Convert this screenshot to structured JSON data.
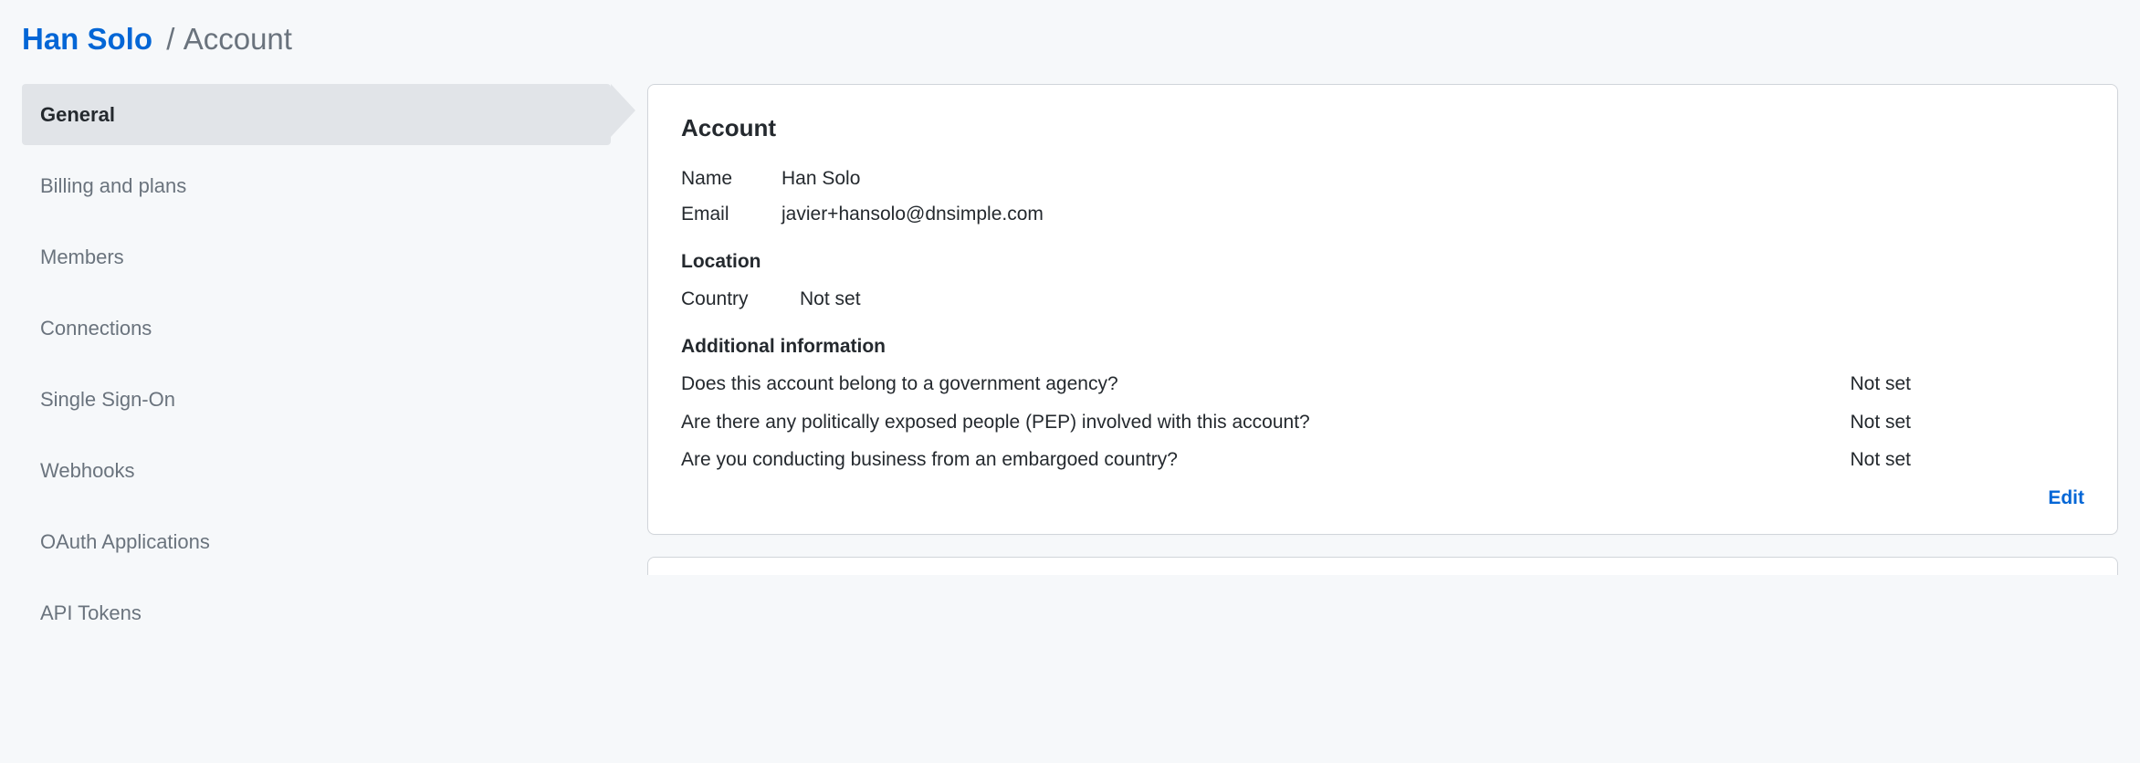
{
  "breadcrumb": {
    "link": "Han Solo",
    "current": "Account"
  },
  "sidebar": {
    "items": [
      {
        "label": "General",
        "active": true
      },
      {
        "label": "Billing and plans",
        "active": false
      },
      {
        "label": "Members",
        "active": false
      },
      {
        "label": "Connections",
        "active": false
      },
      {
        "label": "Single Sign-On",
        "active": false
      },
      {
        "label": "Webhooks",
        "active": false
      },
      {
        "label": "OAuth Applications",
        "active": false
      },
      {
        "label": "API Tokens",
        "active": false
      }
    ]
  },
  "account": {
    "title": "Account",
    "name_label": "Name",
    "name_value": "Han Solo",
    "email_label": "Email",
    "email_value": "javier+hansolo@dnsimple.com",
    "location_heading": "Location",
    "country_label": "Country",
    "country_value": "Not set",
    "additional_heading": "Additional information",
    "questions": [
      {
        "q": "Does this account belong to a government agency?",
        "a": "Not set"
      },
      {
        "q": "Are there any politically exposed people (PEP) involved with this account?",
        "a": "Not set"
      },
      {
        "q": "Are you conducting business from an embargoed country?",
        "a": "Not set"
      }
    ],
    "edit_label": "Edit"
  }
}
